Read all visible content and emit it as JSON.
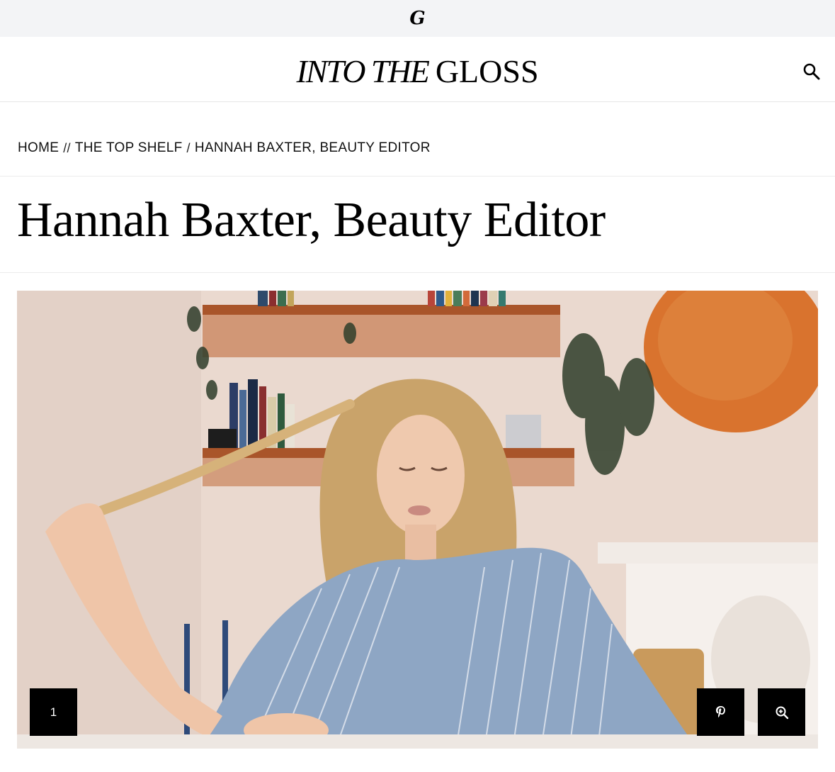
{
  "topbar": {
    "brand_mark": "G",
    "brand_icon": "glossier-g-icon"
  },
  "header": {
    "logo_italic": "INTO THE",
    "logo_roman": "GLOSS",
    "search_icon": "search-icon"
  },
  "breadcrumb": {
    "home": "HOME",
    "sep1": "//",
    "section": "THE TOP SHELF",
    "sep2": "/",
    "current": "HANNAH BAXTER, BEAUTY EDITOR"
  },
  "article": {
    "title": "Hannah Baxter, Beauty Editor"
  },
  "gallery": {
    "counter": "1",
    "pin_icon": "pinterest-icon",
    "zoom_icon": "zoom-in-icon",
    "colors": {
      "wall": "#ead9cf",
      "shelf": "#b8612f",
      "mirror": "#d9732e",
      "shirt": "#8ea6c4",
      "hair": "#c9a36a",
      "control_bg": "#000000"
    }
  }
}
